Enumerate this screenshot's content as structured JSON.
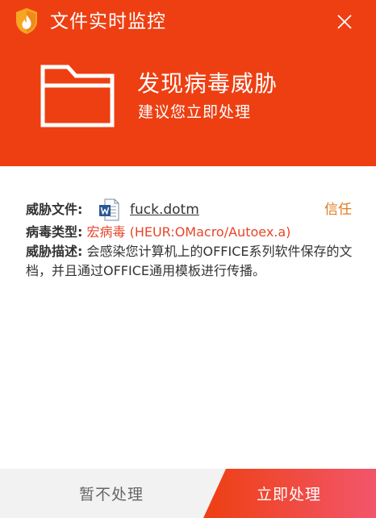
{
  "window": {
    "title": "文件实时监控",
    "close_label": "关闭"
  },
  "alert": {
    "title": "发现病毒威胁",
    "subtitle": "建议您立即处理"
  },
  "details": {
    "file_label": "威胁文件:",
    "file_name": "fuck.dotm",
    "file_icon": "word-document-icon",
    "trust_label": "信任",
    "virus_type_label": "病毒类型:",
    "virus_type_value": "宏病毒 (HEUR:OMacro/Autoex.a)",
    "description_label": "威胁描述:",
    "description_text": "会感染您计算机上的OFFICE系列软件保存的文档，并且通过OFFICE通用模板进行传播。"
  },
  "actions": {
    "later_label": "暂不处理",
    "now_label": "立即处理"
  },
  "colors": {
    "header_red": "#ee3f12",
    "trust_orange": "#e07a1f",
    "virus_red": "#e8452a",
    "button_gradient_start": "#ee3f12",
    "button_gradient_end": "#f2566b",
    "footer_gray": "#f2f2f2"
  }
}
